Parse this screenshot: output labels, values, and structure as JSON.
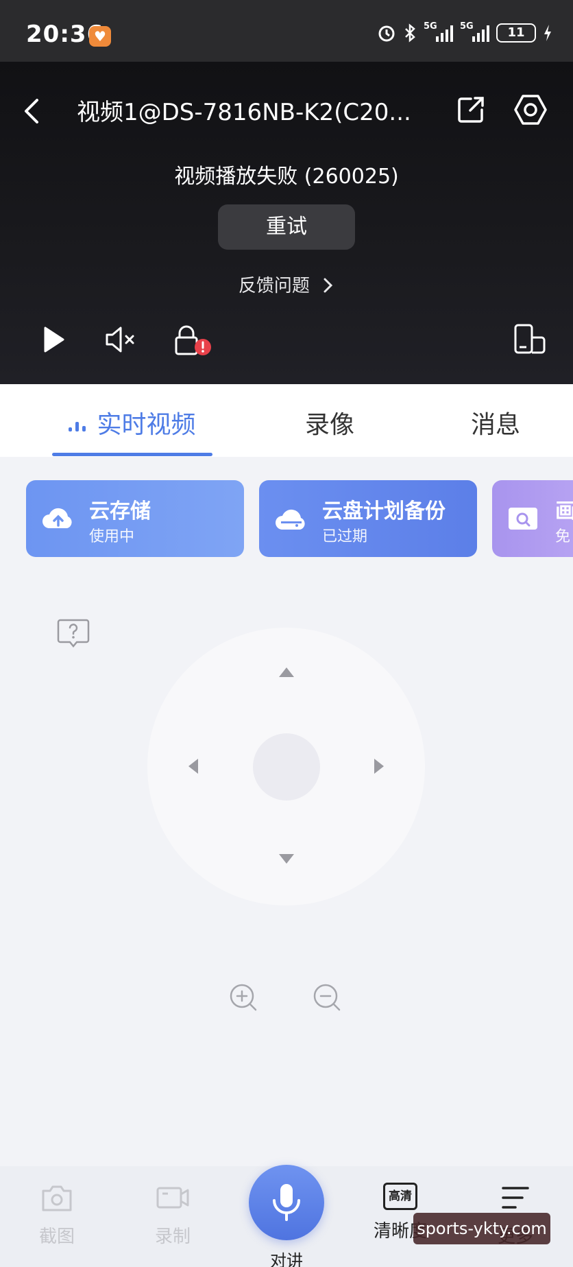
{
  "status_bar": {
    "time": "20:36",
    "signal1_label": "5G",
    "signal2_label": "5G",
    "battery": "11"
  },
  "header": {
    "title": "视频1@DS-7816NB-K2(C20..."
  },
  "player": {
    "error_message": "视频播放失败 (260025)",
    "retry_label": "重试",
    "feedback_label": "反馈问题"
  },
  "tabs": [
    {
      "label": "实时视频",
      "active": true
    },
    {
      "label": "录像",
      "active": false
    },
    {
      "label": "消息",
      "active": false
    }
  ],
  "service_cards": [
    {
      "title": "云存储",
      "subtitle": "使用中",
      "icon": "cloud-upload-icon"
    },
    {
      "title": "云盘计划备份",
      "subtitle": "已过期",
      "icon": "cloud-drive-icon"
    },
    {
      "title": "画",
      "subtitle": "免",
      "icon": "image-search-icon"
    }
  ],
  "bottom_bar": {
    "screenshot_label": "截图",
    "record_label": "录制",
    "talk_label": "对讲",
    "quality_badge": "高清",
    "quality_label": "清晰度",
    "more_label": "更多"
  },
  "watermark": "sports-ykty.com",
  "colors": {
    "accent": "#4e7ce6",
    "player_bg": "#141417",
    "error_badge": "#e8414a"
  }
}
